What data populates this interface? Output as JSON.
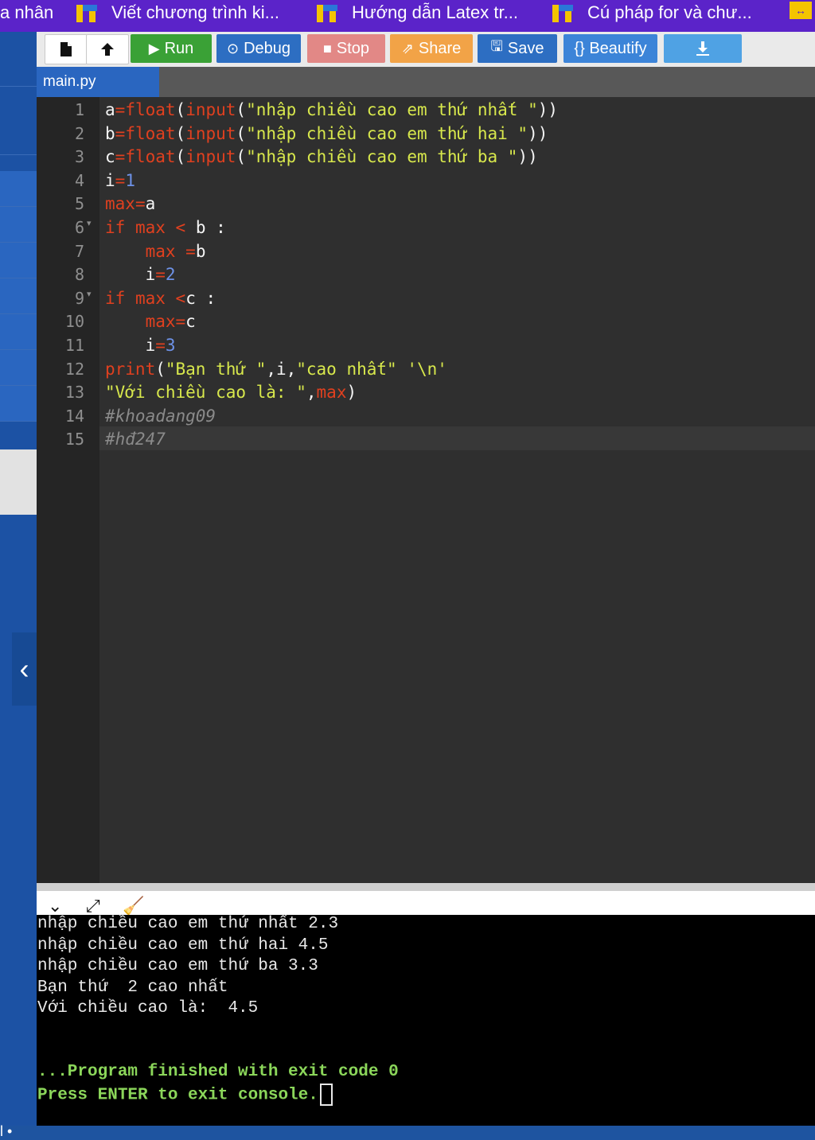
{
  "bookmarks": [
    {
      "label": "a nhân"
    },
    {
      "label": "Viết chương trình ki..."
    },
    {
      "label": "Hướng dẫn Latex tr..."
    },
    {
      "label": "Cú pháp for và chư..."
    }
  ],
  "toolbar": {
    "run": "Run",
    "debug": "Debug",
    "stop": "Stop",
    "share": "Share",
    "save": "Save",
    "beautify": "{} Beautify",
    "colors": {
      "run": "#3aa136",
      "debug": "#2d6ec2",
      "stop": "#e28886",
      "share": "#f2a347",
      "save": "#2d6ec2",
      "beautify": "#3c84d8",
      "download": "#4fa2e4"
    }
  },
  "file_tab": {
    "name": "main.py"
  },
  "editor": {
    "line_numbers": [
      "1",
      "2",
      "3",
      "4",
      "5",
      "6",
      "7",
      "8",
      "9",
      "10",
      "11",
      "12",
      "13",
      "14",
      "15"
    ],
    "lines": [
      [
        [
          "plain",
          "a"
        ],
        [
          "kw",
          "="
        ],
        [
          "kw",
          "float"
        ],
        [
          "plain",
          "("
        ],
        [
          "kw",
          "input"
        ],
        [
          "plain",
          "("
        ],
        [
          "str",
          "\"nhập chiều cao em thứ nhất \""
        ],
        [
          "plain",
          "))"
        ]
      ],
      [
        [
          "plain",
          "b"
        ],
        [
          "kw",
          "="
        ],
        [
          "kw",
          "float"
        ],
        [
          "plain",
          "("
        ],
        [
          "kw",
          "input"
        ],
        [
          "plain",
          "("
        ],
        [
          "str",
          "\"nhập chiều cao em thứ hai \""
        ],
        [
          "plain",
          "))"
        ]
      ],
      [
        [
          "plain",
          "c"
        ],
        [
          "kw",
          "="
        ],
        [
          "kw",
          "float"
        ],
        [
          "plain",
          "("
        ],
        [
          "kw",
          "input"
        ],
        [
          "plain",
          "("
        ],
        [
          "str",
          "\"nhập chiều cao em thứ ba \""
        ],
        [
          "plain",
          "))"
        ]
      ],
      [
        [
          "plain",
          "i"
        ],
        [
          "kw",
          "="
        ],
        [
          "num",
          "1"
        ]
      ],
      [
        [
          "kw",
          "max"
        ],
        [
          "kw",
          "="
        ],
        [
          "plain",
          "a"
        ]
      ],
      [
        [
          "kw",
          "if "
        ],
        [
          "kw",
          "max"
        ],
        [
          "plain",
          " "
        ],
        [
          "kw",
          "<"
        ],
        [
          "plain",
          " b :"
        ]
      ],
      [
        [
          "plain",
          "    "
        ],
        [
          "kw",
          "max"
        ],
        [
          "plain",
          " "
        ],
        [
          "kw",
          "="
        ],
        [
          "plain",
          "b"
        ]
      ],
      [
        [
          "plain",
          "    i"
        ],
        [
          "kw",
          "="
        ],
        [
          "num",
          "2"
        ]
      ],
      [
        [
          "kw",
          "if "
        ],
        [
          "kw",
          "max"
        ],
        [
          "plain",
          " "
        ],
        [
          "kw",
          "<"
        ],
        [
          "plain",
          "c :"
        ]
      ],
      [
        [
          "plain",
          "    "
        ],
        [
          "kw",
          "max"
        ],
        [
          "kw",
          "="
        ],
        [
          "plain",
          "c"
        ]
      ],
      [
        [
          "plain",
          "    i"
        ],
        [
          "kw",
          "="
        ],
        [
          "num",
          "3"
        ]
      ],
      [
        [
          "kw",
          "print"
        ],
        [
          "plain",
          "("
        ],
        [
          "str",
          "\"Bạn thứ \""
        ],
        [
          "plain",
          ",i,"
        ],
        [
          "str",
          "\"cao nhất\""
        ],
        [
          "plain",
          " "
        ],
        [
          "str",
          "'\\n'"
        ]
      ],
      [
        [
          "str",
          "\"Với chiều cao là: \""
        ],
        [
          "plain",
          ","
        ],
        [
          "kw",
          "max"
        ],
        [
          "plain",
          ")"
        ]
      ],
      [
        [
          "cm",
          "#khoadang09"
        ]
      ],
      [
        [
          "cm",
          "#hđ247"
        ]
      ]
    ]
  },
  "console": {
    "lines": [
      "nhập chiều cao em thứ nhất 2.3",
      "nhập chiều cao em thứ hai 4.5",
      "nhập chiều cao em thứ ba 3.3",
      "Bạn thứ  2 cao nhất",
      "Với chiều cao là:  4.5"
    ],
    "finished": "...Program finished with exit code 0",
    "press_enter": "Press ENTER to exit console."
  },
  "sidebar": {
    "footer": "l •"
  }
}
